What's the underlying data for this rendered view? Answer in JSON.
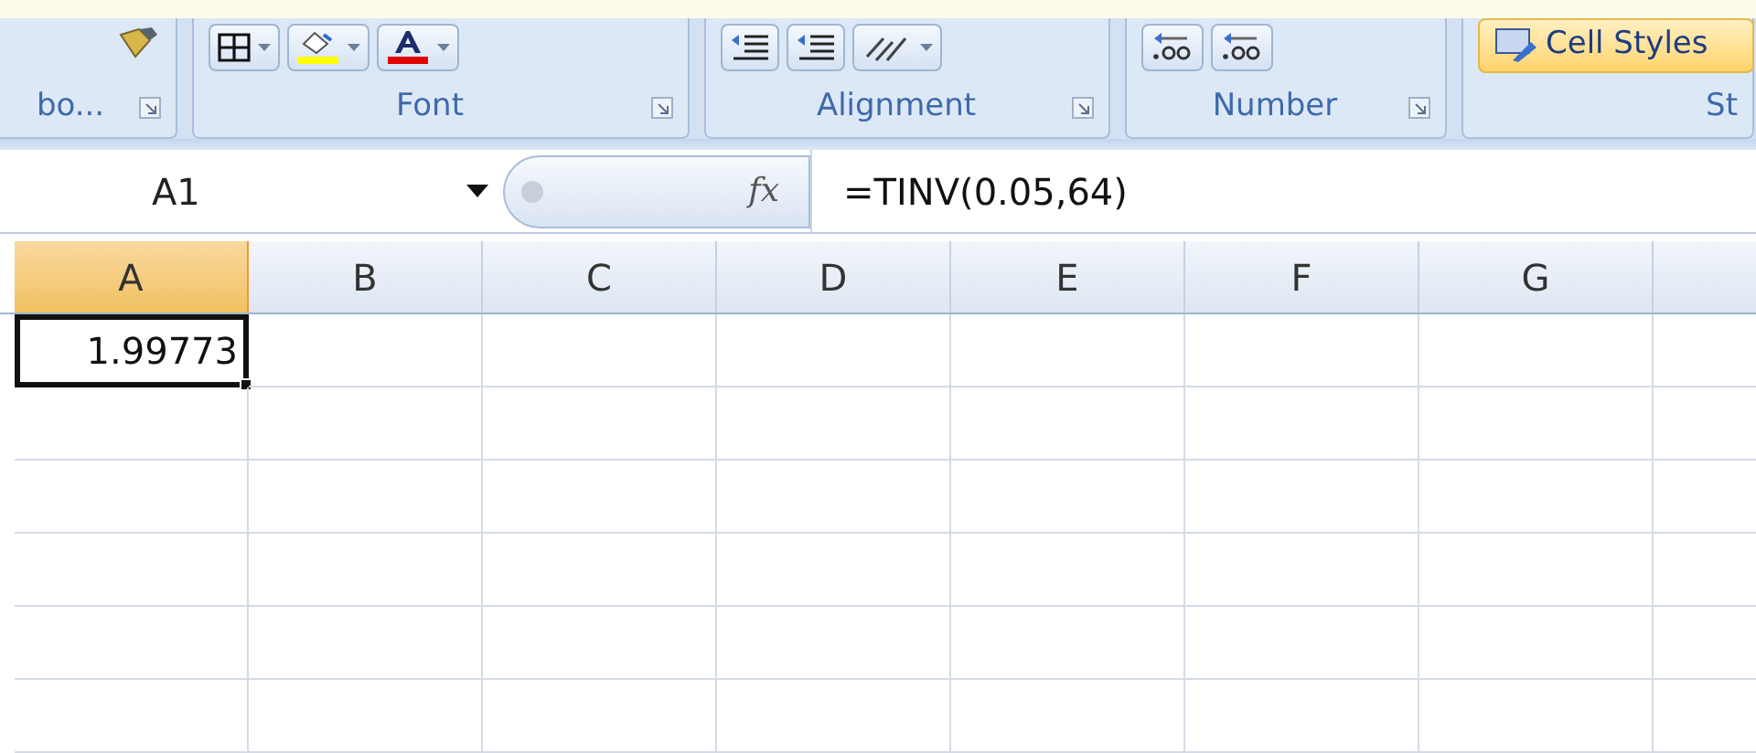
{
  "ribbon": {
    "groups": [
      {
        "label": "bo...",
        "tools": [
          {
            "kind": "paint-brush"
          }
        ]
      },
      {
        "label": "Font",
        "tools": [
          {
            "kind": "borders"
          },
          {
            "kind": "fill-color"
          },
          {
            "kind": "font-color"
          }
        ]
      },
      {
        "label": "Alignment",
        "tools": [
          {
            "kind": "decrease-indent"
          },
          {
            "kind": "increase-indent"
          },
          {
            "kind": "orientation"
          }
        ]
      },
      {
        "label": "Number",
        "tools": [
          {
            "kind": "increase-decimal"
          },
          {
            "kind": "decrease-decimal"
          }
        ]
      },
      {
        "label": "St",
        "tools": [
          {
            "kind": "cell-styles",
            "label": "Cell Styles"
          }
        ]
      }
    ]
  },
  "formula_bar": {
    "name_box": "A1",
    "function_button": "fx",
    "formula": "=TINV(0.05,64)"
  },
  "sheet": {
    "columns": [
      {
        "label": "A",
        "selected": true
      },
      {
        "label": "B",
        "selected": false
      },
      {
        "label": "C",
        "selected": false
      },
      {
        "label": "D",
        "selected": false
      },
      {
        "label": "E",
        "selected": false
      },
      {
        "label": "F",
        "selected": false
      },
      {
        "label": "G",
        "selected": false
      }
    ],
    "rows": [
      {
        "selected": true,
        "cells": [
          "1.99773",
          "",
          "",
          "",
          "",
          "",
          ""
        ]
      },
      {
        "selected": false,
        "cells": [
          "",
          "",
          "",
          "",
          "",
          "",
          ""
        ]
      },
      {
        "selected": false,
        "cells": [
          "",
          "",
          "",
          "",
          "",
          "",
          ""
        ]
      },
      {
        "selected": false,
        "cells": [
          "",
          "",
          "",
          "",
          "",
          "",
          ""
        ]
      },
      {
        "selected": false,
        "cells": [
          "",
          "",
          "",
          "",
          "",
          "",
          ""
        ]
      },
      {
        "selected": false,
        "cells": [
          "",
          "",
          "",
          "",
          "",
          "",
          ""
        ]
      }
    ]
  }
}
